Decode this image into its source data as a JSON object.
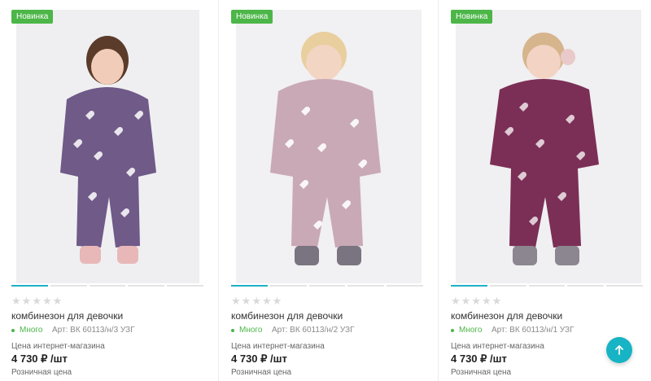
{
  "colors": {
    "badge": "#4cb648",
    "accent": "#1fb0c8",
    "stock": "#4cb648",
    "scroll_button": "#16b4c4"
  },
  "products": [
    {
      "badge": "Новинка",
      "title": "комбинезон для девочки",
      "stock": "Много",
      "article": "Арт: ВК 60113/н/3 УЗГ",
      "price_label": "Цена интернет-магазина",
      "price": "4 730 ₽ /шт",
      "retail_label": "Розничная цена",
      "rating": 0,
      "garment_color": "#6f5a88",
      "slides": 5,
      "active_slide": 0
    },
    {
      "badge": "Новинка",
      "title": "комбинезон для девочки",
      "stock": "Много",
      "article": "Арт: ВК 60113/н/2 УЗГ",
      "price_label": "Цена интернет-магазина",
      "price": "4 730 ₽ /шт",
      "retail_label": "Розничная цена",
      "rating": 0,
      "garment_color": "#c9a9b6",
      "slides": 5,
      "active_slide": 0
    },
    {
      "badge": "Новинка",
      "title": "комбинезон для девочки",
      "stock": "Много",
      "article": "Арт: ВК 60113/н/1 УЗГ",
      "price_label": "Цена интернет-магазина",
      "price": "4 730 ₽ /шт",
      "retail_label": "Розничная цена",
      "rating": 0,
      "garment_color": "#7b2f56",
      "slides": 5,
      "active_slide": 0
    }
  ],
  "scroll_top_icon": "arrow-up-icon"
}
